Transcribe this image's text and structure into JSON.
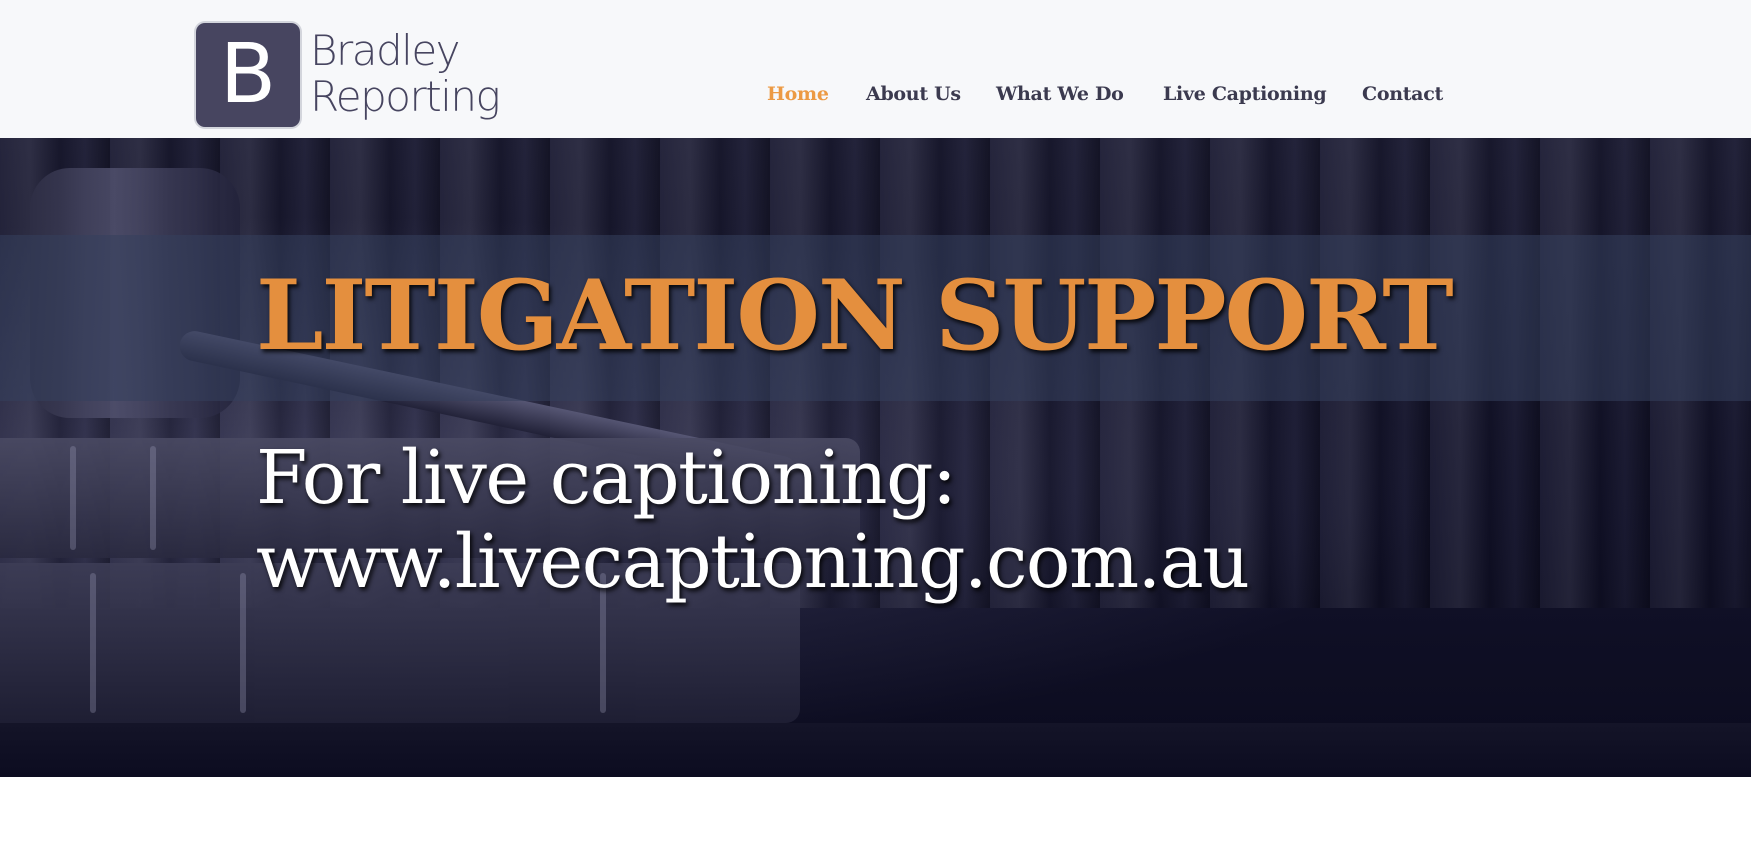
{
  "brand": {
    "logo_letter": "B",
    "name_line1": "Bradley",
    "name_line2": "Reporting"
  },
  "nav": {
    "items": [
      {
        "label": "Home",
        "active": true
      },
      {
        "label": "About Us",
        "active": false
      },
      {
        "label": "What We Do",
        "active": false
      },
      {
        "label": "Live Captioning",
        "active": false
      },
      {
        "label": "Contact",
        "active": false
      }
    ]
  },
  "hero": {
    "title": "LITIGATION SUPPORT",
    "subtitle_line1": "For live captioning:",
    "subtitle_line2": "www.livecaptioning.com.au"
  },
  "colors": {
    "accent": "#ec9a44",
    "logo_bg": "#474560",
    "nav_text": "#3b3a4f"
  }
}
